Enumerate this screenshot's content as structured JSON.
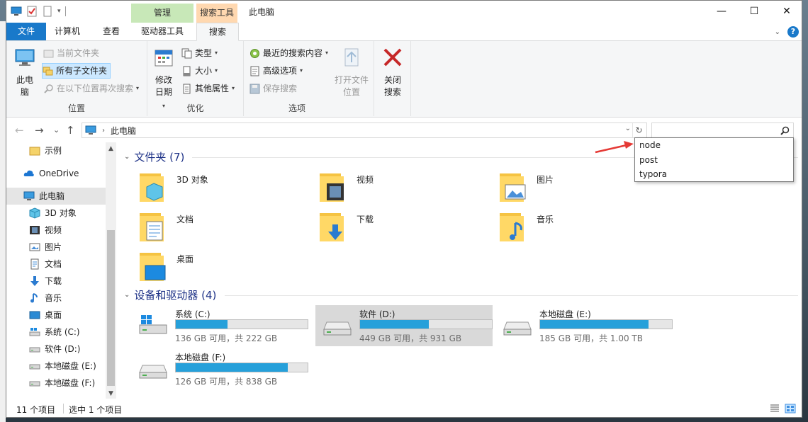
{
  "window": {
    "title": "此电脑",
    "context_tabs": {
      "manage": "管理",
      "search_tools": "搜索工具"
    },
    "controls": {
      "minimize": "—",
      "maximize": "☐",
      "close": "✕"
    }
  },
  "ribbon": {
    "tabs": [
      "文件",
      "计算机",
      "查看",
      "驱动器工具",
      "搜索"
    ],
    "active_tab": "搜索",
    "groups": {
      "location": {
        "label": "位置",
        "this_pc": "此电脑",
        "current_folder": "当前文件夹",
        "all_subfolders": "所有子文件夹",
        "search_again": "在以下位置再次搜索"
      },
      "refine": {
        "label": "优化",
        "date_modified": "修改日期",
        "kind": "类型",
        "size": "大小",
        "other_properties": "其他属性"
      },
      "options": {
        "label": "选项",
        "recent_searches": "最近的搜索内容",
        "advanced_options": "高级选项",
        "save_search": "保存搜索",
        "open_file_location": "打开文件位置"
      },
      "close": {
        "close_search": "关闭搜索"
      }
    }
  },
  "navigation": {
    "back": "←",
    "forward": "→",
    "recent": "⌄",
    "up": "↑",
    "address": "此电脑",
    "search_value": "",
    "suggestions": [
      "node",
      "post",
      "typora"
    ]
  },
  "sidebar": {
    "items": [
      {
        "label": "示例",
        "icon": "folder-icon"
      },
      {
        "label": "OneDrive",
        "icon": "cloud-icon"
      },
      {
        "label": "此电脑",
        "icon": "computer-icon",
        "selected": true
      },
      {
        "label": "3D 对象",
        "icon": "cube-icon"
      },
      {
        "label": "视频",
        "icon": "video-icon"
      },
      {
        "label": "图片",
        "icon": "picture-icon"
      },
      {
        "label": "文档",
        "icon": "document-icon"
      },
      {
        "label": "下载",
        "icon": "download-icon"
      },
      {
        "label": "音乐",
        "icon": "music-icon"
      },
      {
        "label": "桌面",
        "icon": "desktop-icon"
      },
      {
        "label": "系统 (C:)",
        "icon": "windows-drive-icon"
      },
      {
        "label": "软件 (D:)",
        "icon": "drive-icon"
      },
      {
        "label": "本地磁盘 (E:)",
        "icon": "drive-icon"
      },
      {
        "label": "本地磁盘 (F:)",
        "icon": "drive-icon"
      }
    ]
  },
  "content": {
    "folders_header": "文件夹 (7)",
    "folders": [
      {
        "name": "3D 对象",
        "icon": "cube-folder-icon"
      },
      {
        "name": "视频",
        "icon": "video-folder-icon"
      },
      {
        "name": "图片",
        "icon": "picture-folder-icon"
      },
      {
        "name": "文档",
        "icon": "document-folder-icon"
      },
      {
        "name": "下载",
        "icon": "download-folder-icon"
      },
      {
        "name": "音乐",
        "icon": "music-folder-icon"
      },
      {
        "name": "桌面",
        "icon": "desktop-folder-icon"
      }
    ],
    "drives_header": "设备和驱动器 (4)",
    "drives": [
      {
        "name": "系统 (C:)",
        "free": "136 GB 可用，共 222 GB",
        "used_fraction": 0.39,
        "selected": false
      },
      {
        "name": "软件 (D:)",
        "free": "449 GB 可用，共 931 GB",
        "used_fraction": 0.52,
        "selected": true
      },
      {
        "name": "本地磁盘 (E:)",
        "free": "185 GB 可用，共 1.00 TB",
        "used_fraction": 0.82,
        "selected": false
      },
      {
        "name": "本地磁盘 (F:)",
        "free": "126 GB 可用，共 838 GB",
        "used_fraction": 0.85,
        "selected": false
      }
    ]
  },
  "statusbar": {
    "item_count": "11 个项目",
    "selected": "选中 1 个项目"
  },
  "colors": {
    "accent": "#1979ca",
    "drive_bar": "#26a0da",
    "annotation_arrow": "#e53935"
  }
}
